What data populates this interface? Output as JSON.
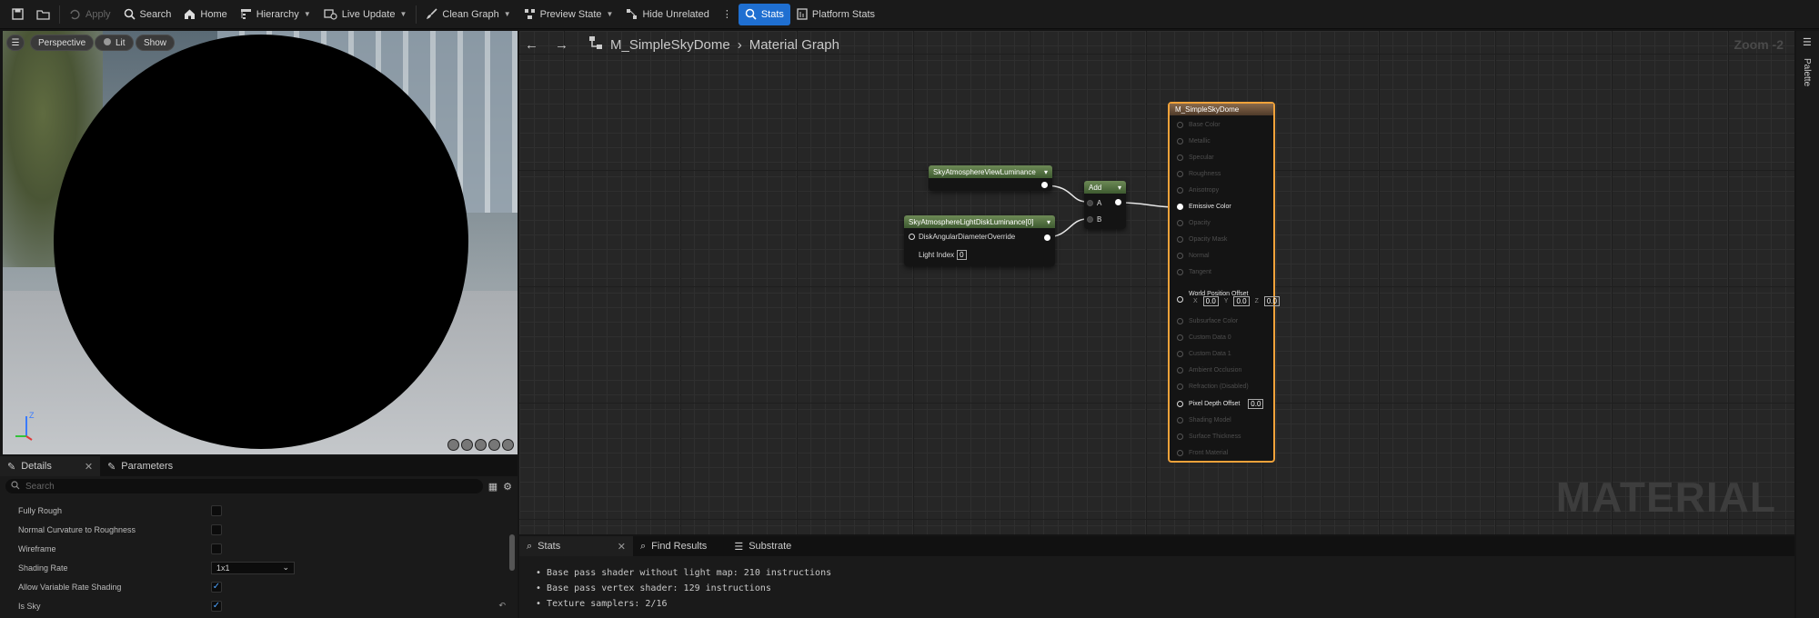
{
  "toolbar": {
    "apply": "Apply",
    "search": "Search",
    "home": "Home",
    "hierarchy": "Hierarchy",
    "live_update": "Live Update",
    "clean_graph": "Clean Graph",
    "preview_state": "Preview State",
    "hide_unrelated": "Hide Unrelated",
    "stats": "Stats",
    "platform_stats": "Platform Stats"
  },
  "viewport": {
    "perspective": "Perspective",
    "lit": "Lit",
    "show": "Show",
    "axis_z": "Z"
  },
  "graph": {
    "title": "M_SimpleSkyDome",
    "subtitle": "Material Graph",
    "zoom": "Zoom -2",
    "watermark": "MATERIAL",
    "node_view_lum": "SkyAtmosphereViewLuminance",
    "node_light_disk": "SkyAtmosphereLightDiskLuminance[0]",
    "pin_disk_angular": "DiskAngularDiameterOverride",
    "light_index_label": "Light Index",
    "light_index_value": "0",
    "add_node": "Add",
    "add_pin_a": "A",
    "add_pin_b": "B"
  },
  "main_node": {
    "title": "M_SimpleSkyDome",
    "pins": {
      "base_color": "Base Color",
      "metallic": "Metallic",
      "specular": "Specular",
      "roughness": "Roughness",
      "anisotropy": "Anisotropy",
      "emissive": "Emissive Color",
      "opacity": "Opacity",
      "opacity_mask": "Opacity Mask",
      "normal": "Normal",
      "tangent": "Tangent",
      "wpo": "World Position Offset",
      "subsurface": "Subsurface Color",
      "custom0": "Custom Data 0",
      "custom1": "Custom Data 1",
      "ao": "Ambient Occlusion",
      "refraction": "Refraction (Disabled)",
      "pdo": "Pixel Depth Offset",
      "shading_model": "Shading Model",
      "surface_thickness": "Surface Thickness",
      "front_material": "Front Material"
    },
    "wpo_x_label": "X",
    "wpo_x": "0.0",
    "wpo_y_label": "Y",
    "wpo_y": "0.0",
    "wpo_z_label": "Z",
    "wpo_z": "0.0",
    "pdo_value": "0.0"
  },
  "details": {
    "tab_details": "Details",
    "tab_parameters": "Parameters",
    "search_placeholder": "Search",
    "props": {
      "fully_rough": "Fully Rough",
      "normal_curv": "Normal Curvature to Roughness",
      "wireframe": "Wireframe",
      "shading_rate": "Shading Rate",
      "shading_rate_value": "1x1",
      "allow_vrs": "Allow Variable Rate Shading",
      "is_sky": "Is Sky"
    }
  },
  "bottom": {
    "tab_stats": "Stats",
    "tab_find": "Find Results",
    "tab_substrate": "Substrate",
    "stats": [
      "Base pass shader without light map: 210 instructions",
      "Base pass vertex shader: 129 instructions",
      "Texture samplers: 2/16"
    ]
  },
  "palette": {
    "label": "Palette"
  },
  "colors": {
    "accent": "#1f6fd1",
    "selected_node_border": "#f0a23a",
    "function_node_header": "#5a7a44"
  }
}
